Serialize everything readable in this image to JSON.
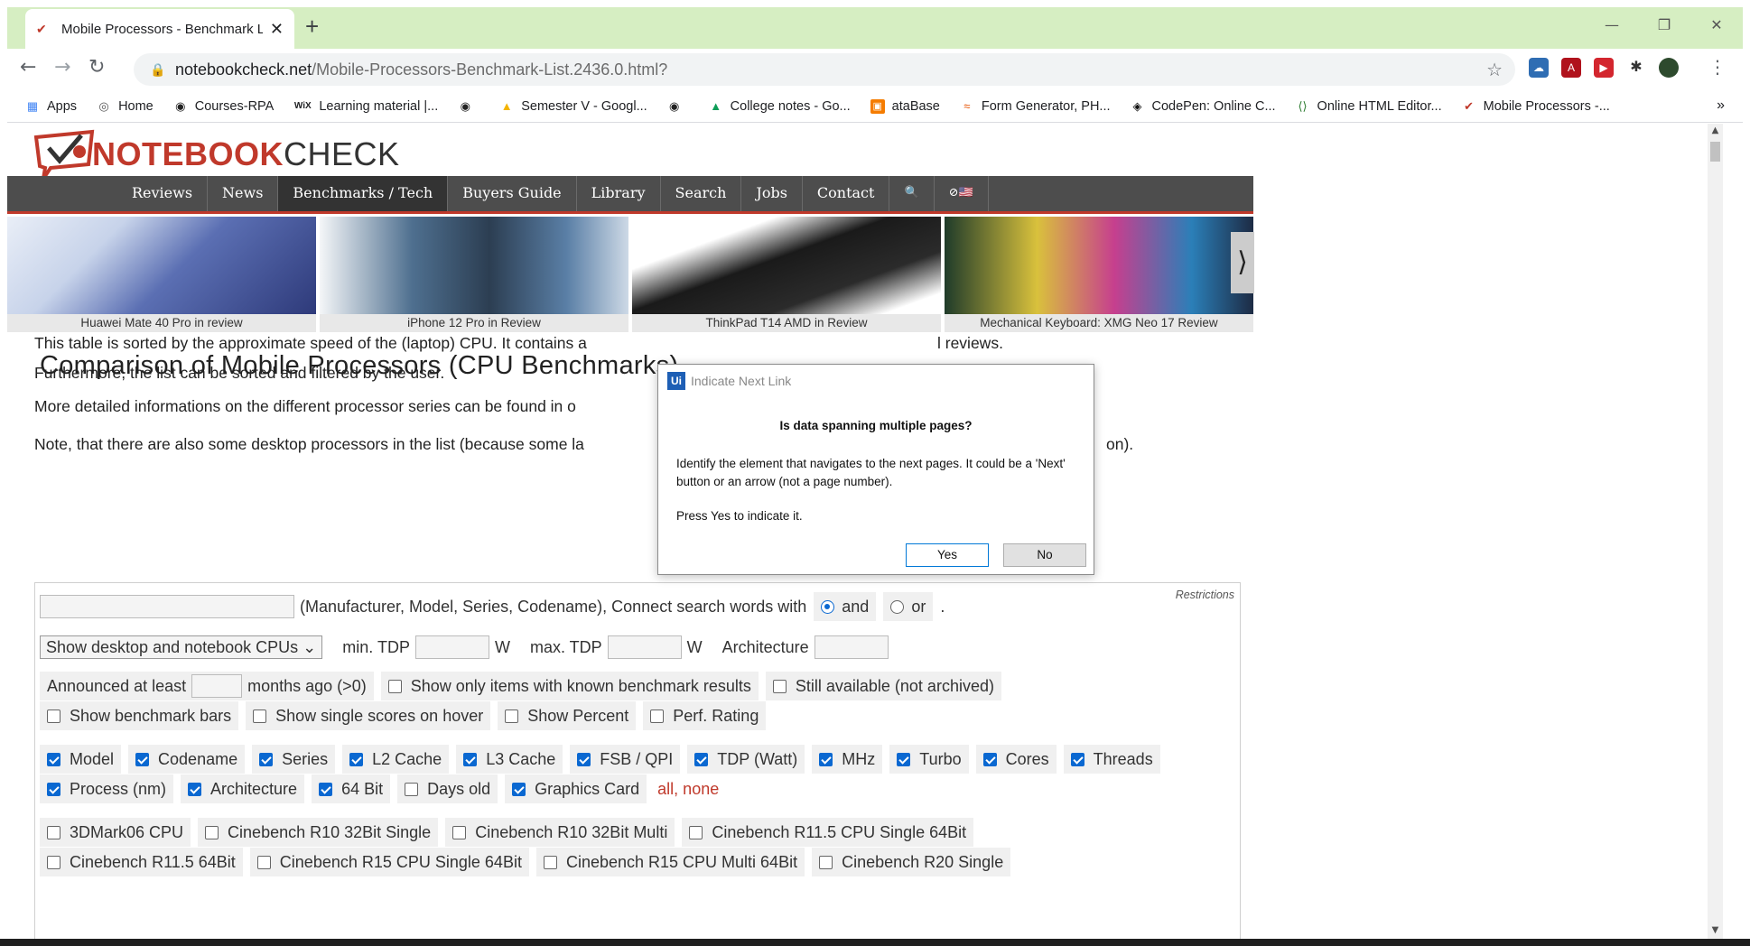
{
  "browser": {
    "tab_title": "Mobile Processors - Benchmark L",
    "tab_close": "✕",
    "new_tab": "+",
    "window_controls": [
      "—",
      "❐",
      "✕"
    ],
    "url_host": "notebookcheck.net",
    "url_path": "/Mobile-Processors-Benchmark-List.2436.0.html?",
    "bookmarks": [
      {
        "label": "Apps",
        "icon": "apps-grid-icon"
      },
      {
        "label": "Home",
        "icon": "globe-icon"
      },
      {
        "label": "Courses-RPA",
        "icon": "globe-icon"
      },
      {
        "label": "Learning material |...",
        "icon": "wix-icon"
      },
      {
        "label": "",
        "icon": "globe-icon"
      },
      {
        "label": "Semester V - Googl...",
        "icon": "drive-icon"
      },
      {
        "label": "",
        "icon": "globe-icon"
      },
      {
        "label": "College notes - Go...",
        "icon": "drive-icon"
      },
      {
        "label": "ataBase",
        "icon": "database-icon"
      },
      {
        "label": "Form Generator, PH...",
        "icon": "form-icon"
      },
      {
        "label": "CodePen: Online C...",
        "icon": "codepen-icon"
      },
      {
        "label": "Online HTML Editor...",
        "icon": "html-icon"
      },
      {
        "label": "Mobile Processors -...",
        "icon": "notebookcheck-icon"
      }
    ],
    "bookmarks_more": "»"
  },
  "site": {
    "logo_red": "NO",
    "logo_red2": "TEBOOK",
    "logo_dark": "CHECK",
    "nav": [
      "Reviews",
      "News",
      "Benchmarks / Tech",
      "Buyers Guide",
      "Library",
      "Search",
      "Jobs",
      "Contact",
      "🔍",
      "⊘🇺🇸"
    ],
    "nav_active_index": 2,
    "teasers": [
      {
        "caption": "Huawei Mate 40 Pro in review"
      },
      {
        "caption": "iPhone 12 Pro in Review"
      },
      {
        "caption": "ThinkPad T14 AMD in Review"
      },
      {
        "caption": "Mechanical Keyboard: XMG Neo 17 Review"
      }
    ],
    "teaser_next": "⟩"
  },
  "content": {
    "title": "Comparison of Mobile Processors (CPU Benchm",
    "title_tail": "arks)",
    "p1_line1": "This table is sorted by the approximate speed of the (laptop) CPU. It contains a",
    "p1_line1_tail": "l reviews.",
    "p1_line2": "Furthermore, the list can be sorted and filtered by the user.",
    "p2": "More detailed informations on the different processor series can be found in o",
    "p3": "Note, that there are also some desktop processors in the list (because some la",
    "p3_tail": "on)."
  },
  "filters": {
    "restrictions": "Restrictions",
    "search_hint": "(Manufacturer, Model, Series, Codename), Connect search words with",
    "and": "and",
    "or": "or",
    "dot": ".",
    "cpu_select": "Show desktop and notebook CPUs ⌄",
    "min_tdp": "min. TDP",
    "max_tdp": "max. TDP",
    "w": "W",
    "architecture": "Architecture",
    "announced": "Announced at least",
    "months_ago": "months ago (>0)",
    "row3": [
      {
        "label": "Show only items with known benchmark results",
        "checked": false
      },
      {
        "label": "Still available (not archived)",
        "checked": false
      }
    ],
    "row4": [
      {
        "label": "Show benchmark bars",
        "checked": false
      },
      {
        "label": "Show single scores on hover",
        "checked": false
      },
      {
        "label": "Show Percent",
        "checked": false
      },
      {
        "label": "Perf. Rating",
        "checked": false
      }
    ],
    "row5": [
      {
        "label": "Model",
        "checked": true
      },
      {
        "label": "Codename",
        "checked": true
      },
      {
        "label": "Series",
        "checked": true
      },
      {
        "label": "L2 Cache",
        "checked": true
      },
      {
        "label": "L3 Cache",
        "checked": true
      },
      {
        "label": "FSB / QPI",
        "checked": true
      },
      {
        "label": "TDP (Watt)",
        "checked": true
      },
      {
        "label": "MHz",
        "checked": true
      },
      {
        "label": "Turbo",
        "checked": true
      },
      {
        "label": "Cores",
        "checked": true
      },
      {
        "label": "Threads",
        "checked": true
      }
    ],
    "row6": [
      {
        "label": "Process (nm)",
        "checked": true
      },
      {
        "label": "Architecture",
        "checked": true
      },
      {
        "label": "64 Bit",
        "checked": true
      },
      {
        "label": "Days old",
        "checked": false
      },
      {
        "label": "Graphics Card",
        "checked": true
      }
    ],
    "all_none": "all, none",
    "row7": [
      {
        "label": "3DMark06 CPU",
        "checked": false
      },
      {
        "label": "Cinebench R10 32Bit Single",
        "checked": false
      },
      {
        "label": "Cinebench R10 32Bit Multi",
        "checked": false
      },
      {
        "label": "Cinebench R11.5 CPU Single 64Bit",
        "checked": false
      }
    ],
    "row8": [
      {
        "label": "Cinebench R11.5 64Bit",
        "checked": false
      },
      {
        "label": "Cinebench R15 CPU Single 64Bit",
        "checked": false
      },
      {
        "label": "Cinebench R15 CPU Multi 64Bit",
        "checked": false
      },
      {
        "label": "Cinebench R20 Single",
        "checked": false
      }
    ]
  },
  "dialog": {
    "logo": "Ui",
    "title": "Indicate Next Link",
    "question": "Is data spanning multiple pages?",
    "body": "Identify the element that navigates to the next pages. It could be a 'Next' button or an arrow (not a page number).",
    "press": "Press Yes to indicate it.",
    "yes": "Yes",
    "no": "No"
  }
}
